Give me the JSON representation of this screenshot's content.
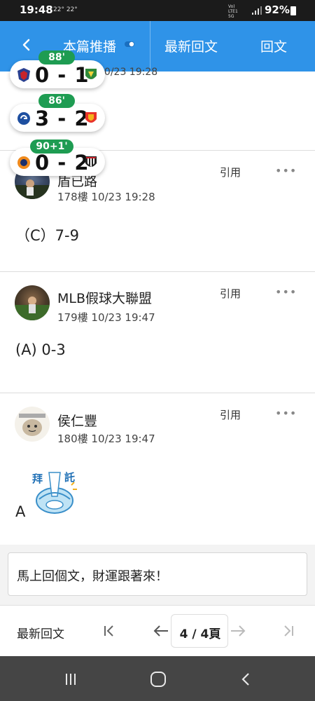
{
  "status_bar": {
    "time": "19:48",
    "temps": "22° 22°",
    "network": [
      "Vo)",
      "LTE1",
      "5G"
    ],
    "battery": "92%"
  },
  "nav": {
    "tabs": [
      "本篇推播",
      "最新回文",
      "回文"
    ]
  },
  "partial_line": "10/23 19:28",
  "posts": [
    {
      "author": "盾已路",
      "floor_time": "178樓   10/23 19:28",
      "quote": "引用",
      "more": "•••",
      "content": "（C）7-9"
    },
    {
      "author": "MLB假球大聯盟",
      "floor_time": "179樓   10/23 19:47",
      "quote": "引用",
      "more": "•••",
      "content": "(A) 0-3"
    },
    {
      "author": "侯仁豐",
      "floor_time": "180樓   10/23 19:47",
      "quote": "引用",
      "more": "•••",
      "content": "A",
      "sticker_text": [
        "拜",
        "託"
      ]
    }
  ],
  "scores": [
    {
      "minute": "88'",
      "score": "0 - 1"
    },
    {
      "minute": "86'",
      "score": "3 - 2"
    },
    {
      "minute": "90+1'",
      "score": "0 - 2"
    }
  ],
  "reply": {
    "placeholder": "馬上回個文，財運跟著來！"
  },
  "pager": {
    "latest": "最新回文",
    "page": "4 / 4頁"
  },
  "colors": {
    "nav_blue": "#2f93e8",
    "minute_green": "#1e9c52"
  }
}
